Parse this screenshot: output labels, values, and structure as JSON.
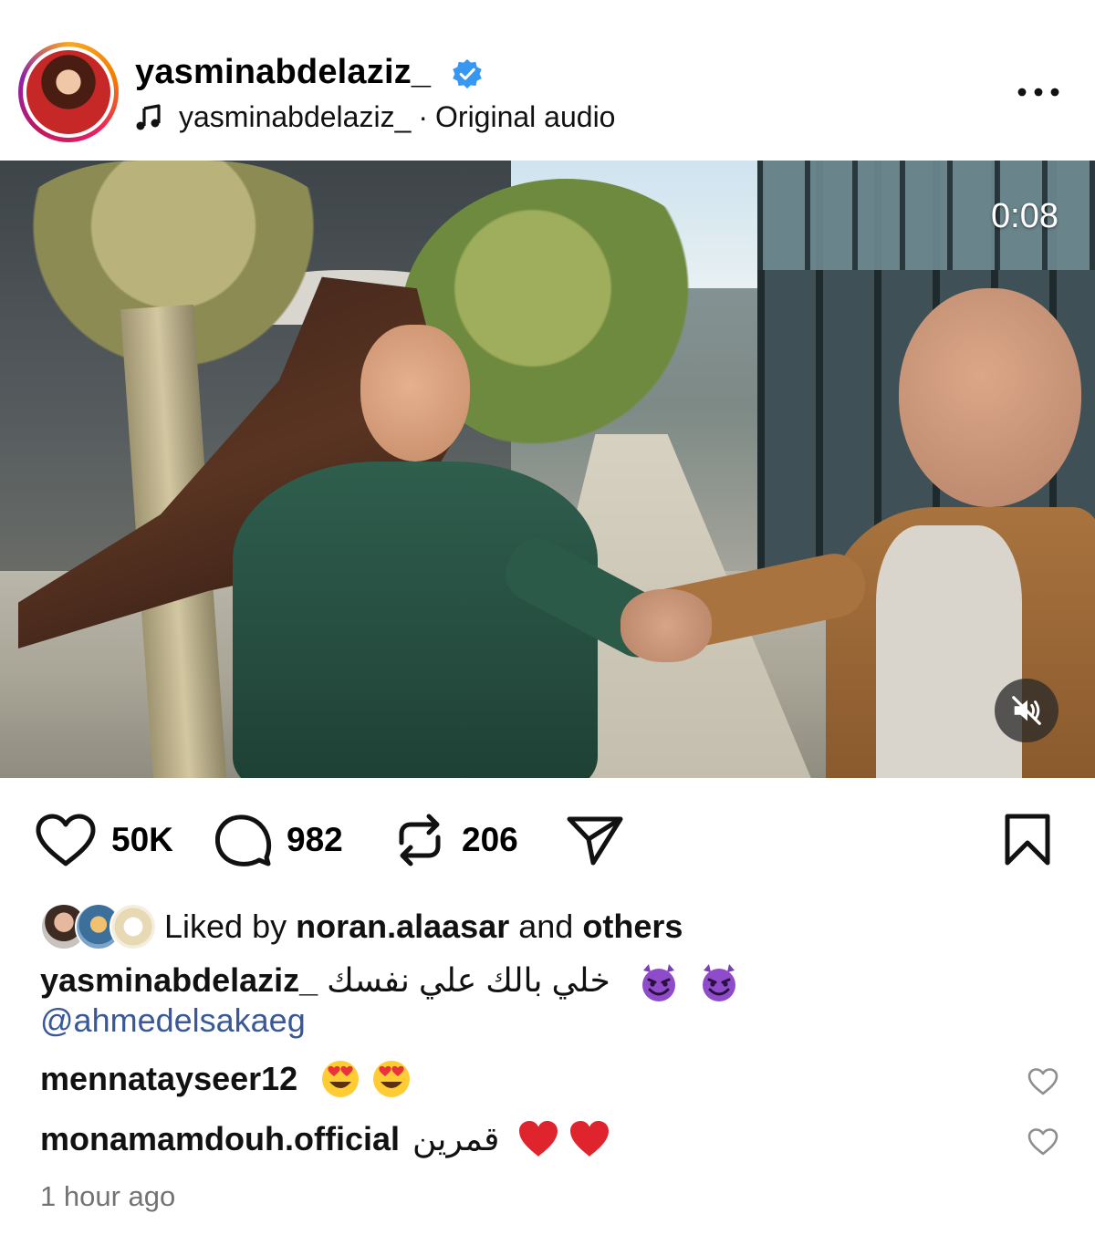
{
  "post": {
    "author": "yasminabdelaziz_",
    "verified": true,
    "audio": {
      "artist": "yasminabdelaziz_",
      "separator": "·",
      "title": "Original audio"
    }
  },
  "media": {
    "timer": "0:08",
    "muted": true
  },
  "actions": {
    "likes": "50K",
    "comments": "982",
    "reposts": "206"
  },
  "likes": {
    "prefix": "Liked by",
    "user": "noran.alaasar",
    "joiner": "and",
    "others": "others"
  },
  "caption": {
    "user": "yasminabdelaziz_",
    "text": "خلي بالك علي نفسك",
    "emoji": [
      "smiling-devil",
      "smiling-devil"
    ],
    "mention": "@ahmedelsakaeg"
  },
  "comments": [
    {
      "user": "mennatayseer12",
      "text": "",
      "emoji": [
        "heart-eyes",
        "heart-eyes"
      ]
    },
    {
      "user": "monamamdouh.official",
      "text": "قمرين",
      "emoji": [
        "red-heart",
        "red-heart"
      ]
    }
  ],
  "timestamp": "1 hour ago",
  "colors": {
    "link": "#385898",
    "verified": "#3897f0",
    "muted_text": "#737373"
  }
}
